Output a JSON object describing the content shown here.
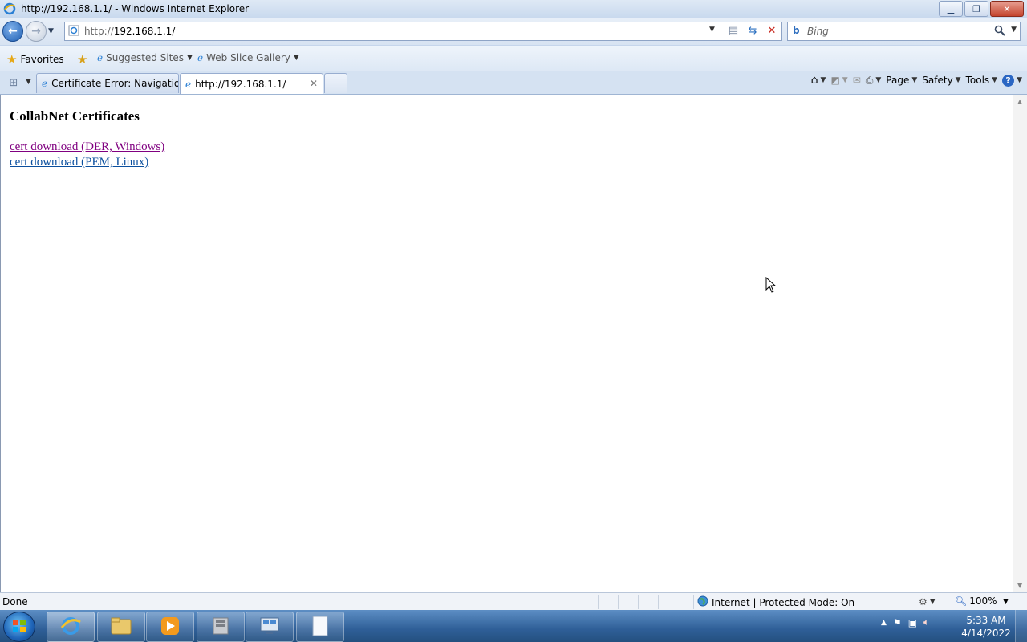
{
  "window": {
    "title": "http://192.168.1.1/ - Windows Internet Explorer"
  },
  "nav": {
    "url_prefix": "http://",
    "url_host": "192.168.1.1/"
  },
  "search": {
    "placeholder": "Bing"
  },
  "favorites": {
    "label": "Favorites",
    "items": [
      {
        "label": "Suggested Sites"
      },
      {
        "label": "Web Slice Gallery"
      }
    ]
  },
  "tabs": [
    {
      "label": "Certificate Error: Navigatio..."
    },
    {
      "label": "http://192.168.1.1/"
    }
  ],
  "commandbar": {
    "page": "Page",
    "safety": "Safety",
    "tools": "Tools"
  },
  "page": {
    "heading": "CollabNet Certificates",
    "links": [
      {
        "label": "cert download (DER, Windows)"
      },
      {
        "label": "cert download (PEM, Linux)"
      }
    ]
  },
  "status": {
    "text": "Done",
    "zone": "Internet | Protected Mode: On",
    "zoom": "100%"
  },
  "clock": {
    "time": "5:33 AM",
    "date": "4/14/2022"
  },
  "colors": {
    "visited_link": "#800080",
    "link": "#0b4f9e",
    "taskbar": "#2f5f98"
  }
}
